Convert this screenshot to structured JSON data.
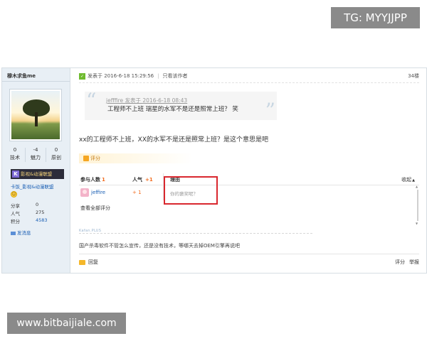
{
  "watermarks": {
    "top": "TG: MYYJJPP",
    "bottom": "www.bitbaijiale.com"
  },
  "author": {
    "name": "穆木求鱼me",
    "stats": [
      {
        "value": "0",
        "label": "技术"
      },
      {
        "value": "-4",
        "label": "魅力"
      },
      {
        "value": "0",
        "label": "原创"
      }
    ],
    "group_badge": "影视&动漫联盟",
    "group_badge_icon": "K",
    "group_link": "卡饭_影视&动漫联盟",
    "info": [
      {
        "label": "分享",
        "value": "0"
      },
      {
        "label": "人气",
        "value": "275"
      },
      {
        "label": "积分",
        "value": "4583"
      }
    ],
    "send_message": "发消息"
  },
  "post": {
    "posted_at": "发表于 2016-6-18 15:29:56",
    "only_author": "只看该作者",
    "floor": "34楼",
    "quote": {
      "header": "jefffire 发表于 2016-6-18 08:43",
      "body": "工程师不上班 瑞星的水军不是还是照常上班？ 笑"
    },
    "content": "xx的工程师不上班，XX的水军不是还是照常上班？是这个意思是吧",
    "rate_label": "评分"
  },
  "rating_table": {
    "participants_label": "参与人数",
    "participants_count": "1",
    "popularity_label": "人气",
    "popularity_total": "+1",
    "reason_label": "理由",
    "collapse_label": "收起",
    "collapse_arrow": "▲",
    "rows": [
      {
        "user": "jeffire",
        "score": "+ 1",
        "reason": "你的褒奖呢？"
      }
    ],
    "view_all": "查看全部评分"
  },
  "signature": {
    "tag": "Kafan.PLUS",
    "text": "国产杀毒软件不管怎么宣传，还是没有技术，等哪天去掉OEM引擎再说吧"
  },
  "footer": {
    "reply": "回复",
    "rate": "评分",
    "report": "举报"
  },
  "colors": {
    "accent_link": "#1a5fb4",
    "orange": "#f26c1e",
    "highlight_red": "#d9272e",
    "sidebar_bg": "#e8eff5"
  }
}
